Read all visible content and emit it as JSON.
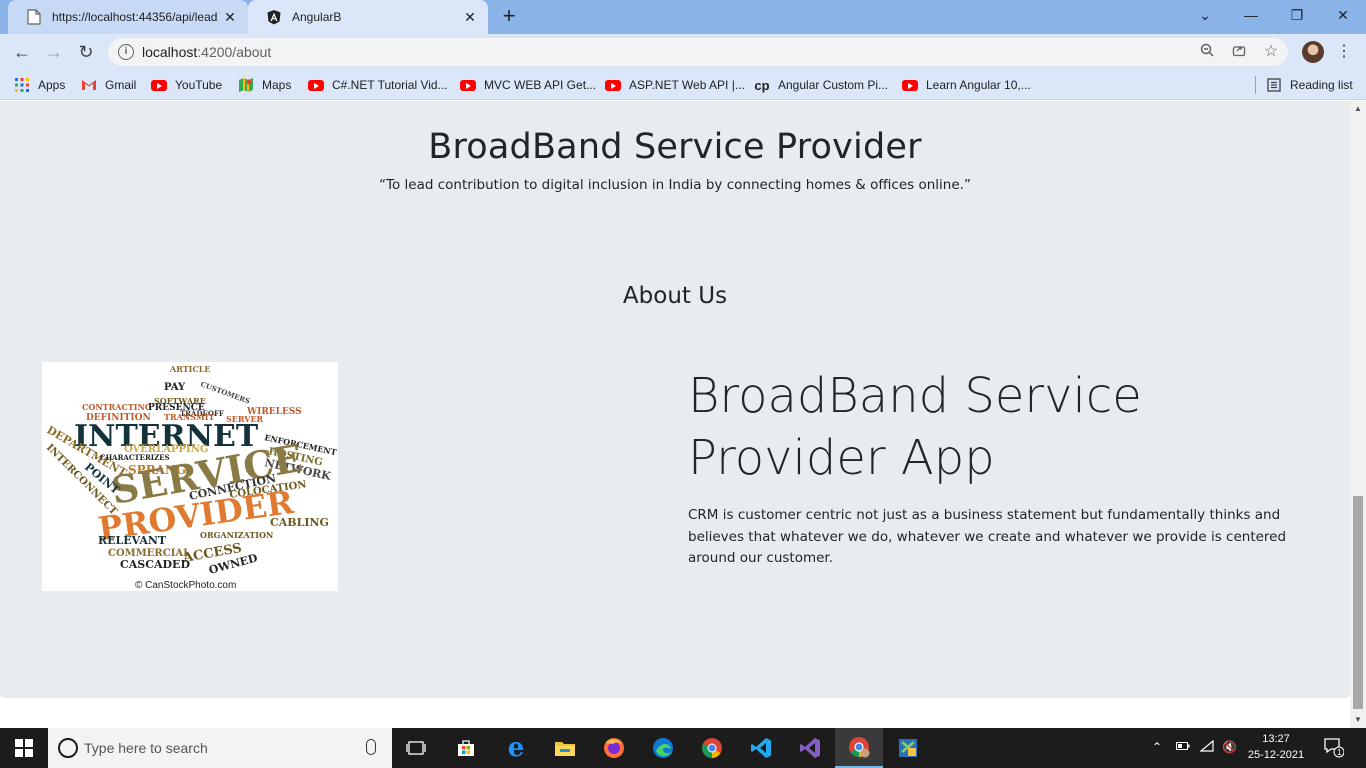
{
  "browser": {
    "tabs": [
      {
        "title": "https://localhost:44356/api/lead",
        "active": false
      },
      {
        "title": "AngularB",
        "active": true
      }
    ],
    "new_tab": "+",
    "url_host": "localhost",
    "url_port_path": ":4200/about",
    "bookmarks": [
      {
        "label": "Apps",
        "icon": "apps-grid-icon"
      },
      {
        "label": "Gmail",
        "icon": "gmail-icon"
      },
      {
        "label": "YouTube",
        "icon": "youtube-icon"
      },
      {
        "label": "Maps",
        "icon": "maps-icon"
      },
      {
        "label": "C#.NET Tutorial Vid...",
        "icon": "youtube-icon"
      },
      {
        "label": "MVC WEB API Get...",
        "icon": "youtube-icon"
      },
      {
        "label": "ASP.NET Web API |...",
        "icon": "youtube-icon"
      },
      {
        "label": "Angular Custom Pi...",
        "icon": "cp-icon"
      },
      {
        "label": "Learn Angular 10,...",
        "icon": "youtube-icon"
      }
    ],
    "reading_list": "Reading list"
  },
  "page": {
    "hero_title": "BroadBand Service Provider",
    "hero_quote": "“To lead contribution to digital inclusion in India by connecting homes & offices online.”",
    "about_heading": "About Us",
    "app_title": "BroadBand Service Provider App",
    "app_description": "CRM is customer centric not just as a business statement but fundamentally thinks and believes that whatever we do, whatever we create and whatever we provide is centered around our customer.",
    "image_credit": "© CanStockPhoto.com",
    "wordcloud_words": [
      "ARTICLE",
      "PAY",
      "CUSTOMERS",
      "CONTRACTING",
      "SOFTWARE",
      "PRESENCE",
      "WIRELESS",
      "TRADEOFF",
      "DEFINITION",
      "TRANSMIT",
      "SERVER",
      "INTERNET",
      "ENFORCEMENT",
      "HOSTING",
      "DEPARTMENT",
      "CHARACTERIZES",
      "OVERLAPPING",
      "NETWORK",
      "SPRANG",
      "INTERCONNECT",
      "SERVICE",
      "POINT",
      "CONNECTION",
      "COLOCATION",
      "PROVIDER",
      "CABLING",
      "RELEVANT",
      "ORGANIZATION",
      "COMMERCIAL",
      "ACCESS",
      "CASCADED",
      "OWNED"
    ]
  },
  "taskbar": {
    "search_placeholder": "Type here to search",
    "time": "13:27",
    "date": "25-12-2021",
    "notification_count": "1"
  },
  "colors": {
    "tabstrip": "#8ab4e8",
    "toolbar": "#dbe7f8",
    "card_bg": "#e9ecef",
    "text": "#212529",
    "taskbar": "#1c1c1c"
  }
}
